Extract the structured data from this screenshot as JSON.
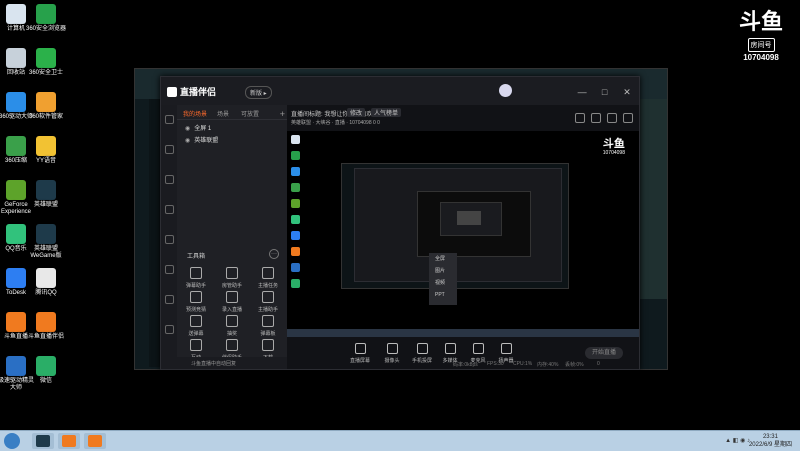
{
  "desktop": {
    "icons": [
      {
        "label": "计算机",
        "color": "#d9e4ef"
      },
      {
        "label": "360安全浏览器",
        "color": "#27a14b"
      },
      {
        "label": "回收站",
        "color": "#c7d1da"
      },
      {
        "label": "360安全卫士",
        "color": "#2bb14a"
      },
      {
        "label": "360驱动大师",
        "color": "#2b8ee8"
      },
      {
        "label": "360软件管家",
        "color": "#f0a030"
      },
      {
        "label": "360压缩",
        "color": "#3aa04a"
      },
      {
        "label": "YY语音",
        "color": "#f2c233"
      },
      {
        "label": "GeForce Experience",
        "color": "#5da32a"
      },
      {
        "label": "英雄联盟",
        "color": "#1e3a4a"
      },
      {
        "label": "QQ音乐",
        "color": "#31c27c"
      },
      {
        "label": "英雄联盟 WeGame版",
        "color": "#1e3a4a"
      },
      {
        "label": "ToDesk",
        "color": "#2d7ef2"
      },
      {
        "label": "腾讯QQ",
        "color": "#e8e8e8"
      },
      {
        "label": "斗鱼直播",
        "color": "#f07a1f"
      },
      {
        "label": "斗鱼直播伴侣",
        "color": "#f07a1f"
      },
      {
        "label": "极速驱动精灵大师",
        "color": "#2a6fc4"
      },
      {
        "label": "微信",
        "color": "#2aae67"
      }
    ]
  },
  "watermark": {
    "logo": "斗鱼",
    "badge": "房间号",
    "room_id": "10704098"
  },
  "app": {
    "logo": "直播伴侣",
    "version_badge": "新版 ▸",
    "window_buttons": [
      "—",
      "□",
      "✕"
    ],
    "tabs": [
      "我的场景",
      "场景",
      "可放置"
    ],
    "add": "+",
    "scenes": [
      "全屏 1",
      "英雄联盟"
    ],
    "tools_title": "工具箱",
    "tools_more": "···",
    "tools": [
      "弹幕助手",
      "房管助手",
      "主播任务",
      "预测竞猜",
      "录入直播",
      "主播助手",
      "送弹幕",
      "抽奖",
      "弹幕板",
      "互动",
      "伴侣助手",
      "下载"
    ],
    "footer": "斗鱼直播中自动回复",
    "stream_title": "直播间标题: 我想让你家里的欢乐不烦",
    "tag1": "修改",
    "tag2": "人气榜单",
    "category": "英雄联盟",
    "subline": "大峡谷 · 直播 · 10704098  0  0",
    "controls": [
      "直播屏幕",
      "摄像头",
      "手机投屏",
      "多媒体",
      "麦克风",
      "扬声器"
    ],
    "go_live": "开始直播",
    "stats": [
      "码率:0kbps",
      "FPS:30",
      "CPU:1%",
      "内存:40%",
      "丢帧:0%",
      "0"
    ],
    "context_menu": [
      "全屏",
      "图片",
      "视频",
      "PPT"
    ]
  },
  "taskbar": {
    "time": "23:31",
    "date": "2022/6/9 星期四"
  }
}
